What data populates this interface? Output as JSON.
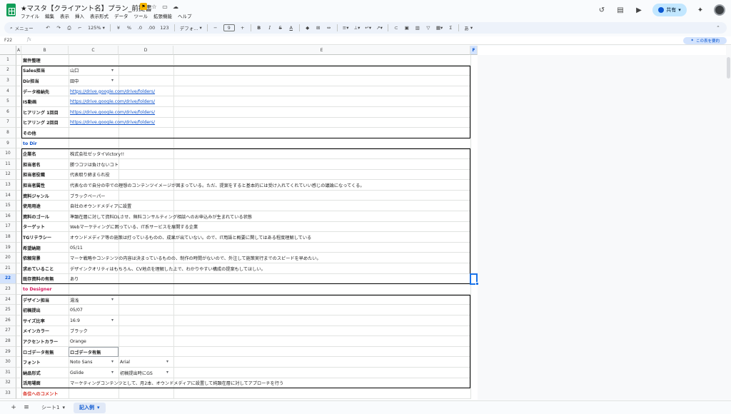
{
  "header": {
    "title": "★マスタ【クライアント名】プラン_前提書",
    "menus": [
      "ファイル",
      "編集",
      "表示",
      "挿入",
      "表示形式",
      "データ",
      "ツール",
      "拡張機能",
      "ヘルプ"
    ],
    "share_label": "共有"
  },
  "toolbar": {
    "search_placeholder": "メニュー",
    "zoom": "125%",
    "currency": "¥",
    "percent": "%",
    "dec_dec": ".0",
    "dec_inc": ".00",
    "number_format": "123",
    "font": "デフォ...",
    "font_size": "9",
    "bold": "B",
    "italic": "I",
    "strike": "S",
    "textcolor": "A",
    "input_tools": "あ"
  },
  "formula_bar": {
    "name_box": "F22",
    "fx": "fx",
    "summary_button": "この表を要約"
  },
  "columns": [
    "A",
    "B",
    "C",
    "D",
    "E",
    "F"
  ],
  "rows": [
    "1",
    "2",
    "3",
    "4",
    "5",
    "6",
    "7",
    "8",
    "9",
    "10",
    "11",
    "12",
    "13",
    "14",
    "15",
    "16",
    "17",
    "18",
    "19",
    "20",
    "21",
    "22",
    "23",
    "24",
    "25",
    "26",
    "27",
    "28",
    "29",
    "30",
    "31",
    "32",
    "33"
  ],
  "sections": {
    "case": "案件整理",
    "to_dir": "to Dir",
    "to_designer": "to Designer",
    "comments": "各位へのコメント"
  },
  "case_rows": [
    {
      "label": "Sales担当",
      "value": "山口",
      "dropdown": true
    },
    {
      "label": "Dir担当",
      "value": "田中",
      "dropdown": true
    },
    {
      "label": "データ格納先",
      "value": "https://drive.google.com/drive/folders/",
      "link": true
    },
    {
      "label": "IS動画",
      "value": "https://drive.google.com/drive/folders/",
      "link": true
    },
    {
      "label": "ヒアリング 1回目",
      "value": "https://drive.google.com/drive/folders/",
      "link": true
    },
    {
      "label": "ヒアリング 2回目",
      "value": "https://drive.google.com/drive/folders/",
      "link": true
    },
    {
      "label": "その他",
      "value": ""
    }
  ],
  "dir_rows": [
    {
      "label": "企業名",
      "value": "株式会社ゼッタイVictory!!"
    },
    {
      "label": "担当者名",
      "value": "勝つコツは負けないコト"
    },
    {
      "label": "担当者役職",
      "value": "代表取り締まられ役"
    },
    {
      "label": "担当者属性",
      "value": "代表なので自分の中での理想のコンテンツイメージが固まっている。ただ、提案をすると基本的には受け入れてくれていい感じの議論になってくる。"
    },
    {
      "label": "資料ジャンル",
      "value": "ブラックペーパー"
    },
    {
      "label": "使用用途",
      "value": "自社のオウンドメディアに設置"
    },
    {
      "label": "資料のゴール",
      "value": "準顕在層に対して資料DLさせ、無料コンサルティング相談へのお申込みが生まれている状態"
    },
    {
      "label": "ターゲット",
      "value": "Webマーケティングに困っている、IT系サービスを展開する企業"
    },
    {
      "label": "TGリテラシー",
      "value": "オウンドメディア等の施策は打っているものの、成果が出ていない。ので、IT用語と概要に関してはある程度理解している"
    },
    {
      "label": "希望納期",
      "value": "05/11"
    },
    {
      "label": "依頼背景",
      "value": "マーケ戦略やコンテンツの内容は決まっているものの、制作の時間がないので、外注して施策実行までのスピードを早めたい。"
    },
    {
      "label": "求めていること",
      "value": "デザインクオリティはもちろん、CV地点を理解した上で、わかりやすい構成の提案もしてほしい。"
    },
    {
      "label": "既存資料の有無",
      "value": "あり"
    }
  ],
  "designer_rows": [
    {
      "label": "デザイン担当",
      "value": "湯浅",
      "dropdown": true
    },
    {
      "label": "初稿提出",
      "value": "05/07"
    },
    {
      "label": "サイズ比率",
      "value": "16:9",
      "dropdown": true
    },
    {
      "label": "メインカラー",
      "value": "ブラック"
    },
    {
      "label": "アクセントカラー",
      "value": "Orange"
    },
    {
      "label": "ロゴデータ有無",
      "value": "ロゴデータ有無",
      "bold_value": true
    },
    {
      "label": "フォント",
      "value": "Noto Sans",
      "dropdown": true,
      "value2": "Arial",
      "dropdown2": true
    },
    {
      "label": "納品形式",
      "value": "Gslide",
      "dropdown": true,
      "value2": "初稿提出時にGS",
      "dropdown2": true
    },
    {
      "label": "活用場面",
      "value": "マーケティングコンテンツとして、月2本、オウンドメディアに設置して純顕在層に対してアプローチを行う"
    }
  ],
  "bottom": {
    "tabs": [
      {
        "label": "シート1",
        "active": false
      },
      {
        "label": "記入例",
        "active": true
      }
    ]
  }
}
